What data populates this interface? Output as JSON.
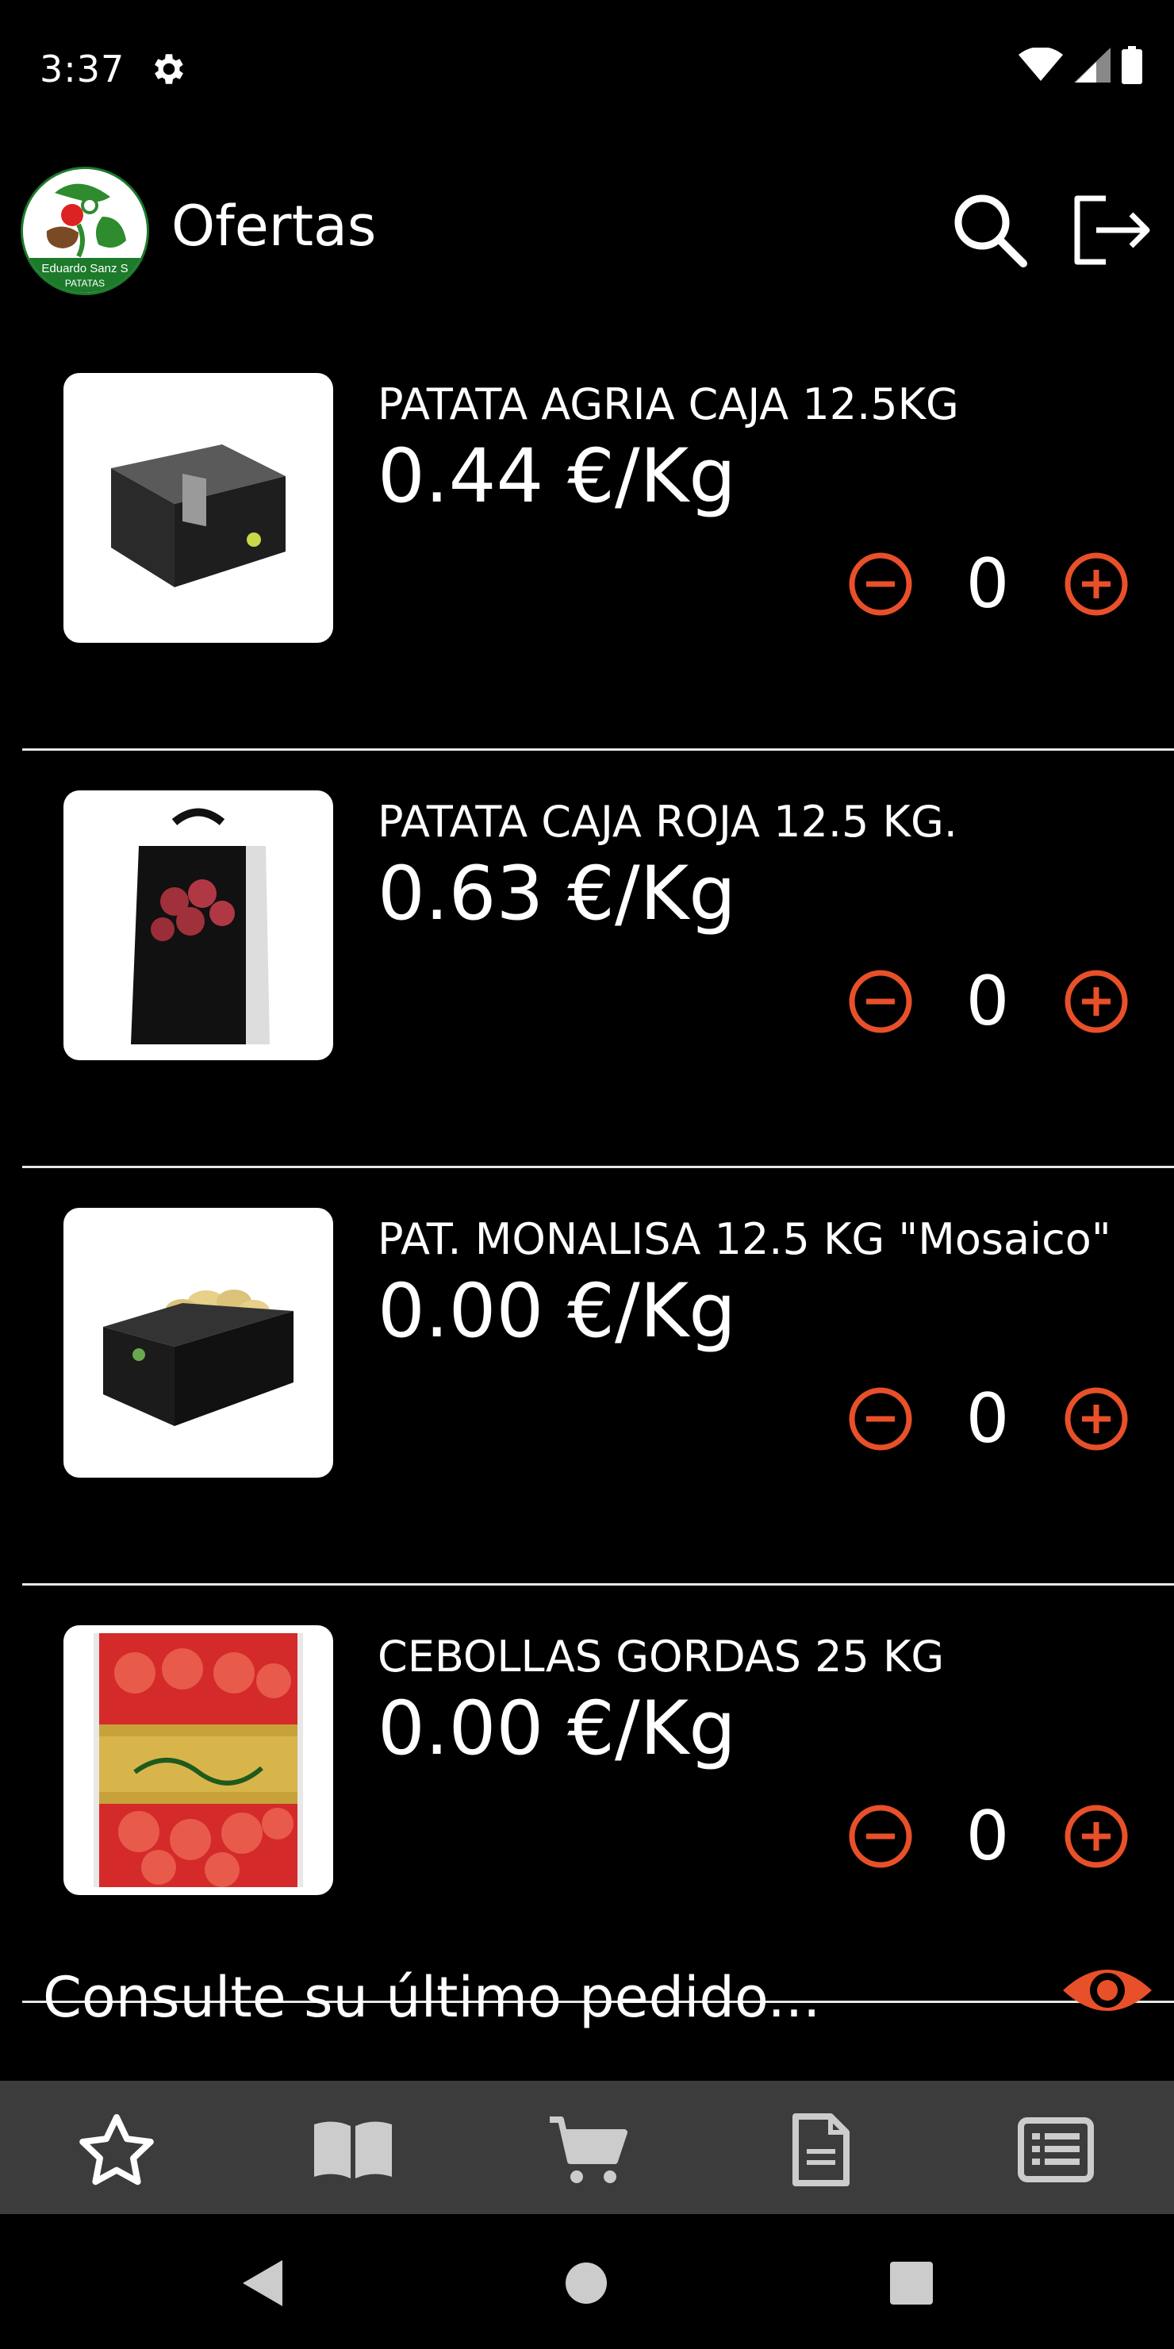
{
  "status_bar": {
    "time": "3:37",
    "icons": [
      "gear-icon",
      "wifi-icon",
      "signal-icon",
      "battery-icon"
    ]
  },
  "app_bar": {
    "title": "Ofertas",
    "logo_text": "Eduardo Sanz S",
    "logo_subtext": "PATATAS",
    "icons": [
      "search-icon",
      "logout-icon"
    ]
  },
  "products": [
    {
      "name": "PATATA AGRIA CAJA 12.5KG",
      "price": "0.44 €/Kg",
      "qty": "0",
      "image": "potato-box"
    },
    {
      "name": "PATATA CAJA ROJA 12.5 KG.",
      "price": "0.63 €/Kg",
      "qty": "0",
      "image": "red-potato-bag"
    },
    {
      "name": "PAT.  MONALISA 12.5 KG \"Mosaico\"",
      "price": "0.00 €/Kg",
      "qty": "0",
      "image": "potato-open-box"
    },
    {
      "name": "CEBOLLAS GORDAS 25 KG",
      "price": "0.00 €/Kg",
      "qty": "0",
      "image": "onion-mesh-bag"
    }
  ],
  "last_order": {
    "text": "Consulte su último pedido...",
    "icon": "eye-icon"
  },
  "bottom_nav": [
    "star-icon",
    "book-icon",
    "cart-icon",
    "document-icon",
    "list-icon"
  ],
  "colors": {
    "accent": "#e8502a",
    "background": "#000000",
    "nav_bg": "#3c3c3c",
    "divider": "#e6e6e6"
  }
}
